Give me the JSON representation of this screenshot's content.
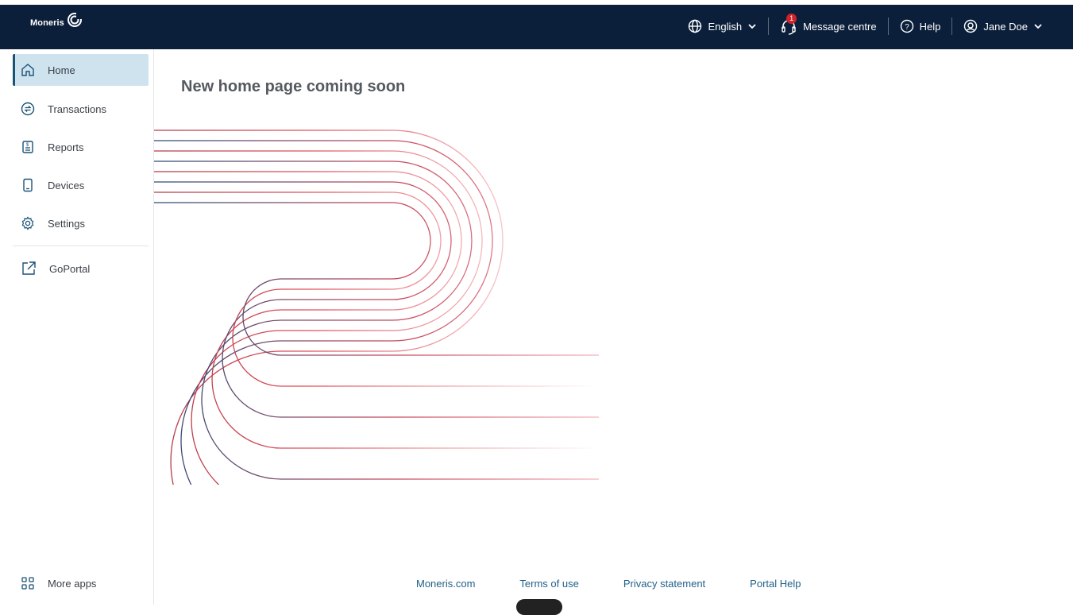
{
  "topbar": {
    "brand_name": "Moneris",
    "language_label": "English",
    "message_centre_label": "Message centre",
    "message_count": "1",
    "help_label": "Help",
    "user_name": "Jane Doe"
  },
  "sidebar": {
    "items": [
      {
        "label": "Home",
        "icon": "home-icon",
        "active": true
      },
      {
        "label": "Transactions",
        "icon": "transactions-icon"
      },
      {
        "label": "Reports",
        "icon": "reports-icon"
      },
      {
        "label": "Devices",
        "icon": "device-icon"
      },
      {
        "label": "Settings",
        "icon": "gear-icon"
      },
      {
        "label": "GoPortal",
        "icon": "external-link-icon"
      }
    ],
    "more_apps_label": "More apps"
  },
  "main": {
    "title": "New home page coming soon"
  },
  "footer": {
    "links": [
      "Moneris.com",
      "Terms of use",
      "Privacy statement",
      "Portal Help"
    ]
  },
  "colors": {
    "topbar_bg": "#0b1f3a",
    "active_bg": "#cfe3ef",
    "link": "#1f5f88",
    "badge": "#d0212a",
    "art_red": "#e0505a",
    "art_blue": "#2a4a78"
  }
}
